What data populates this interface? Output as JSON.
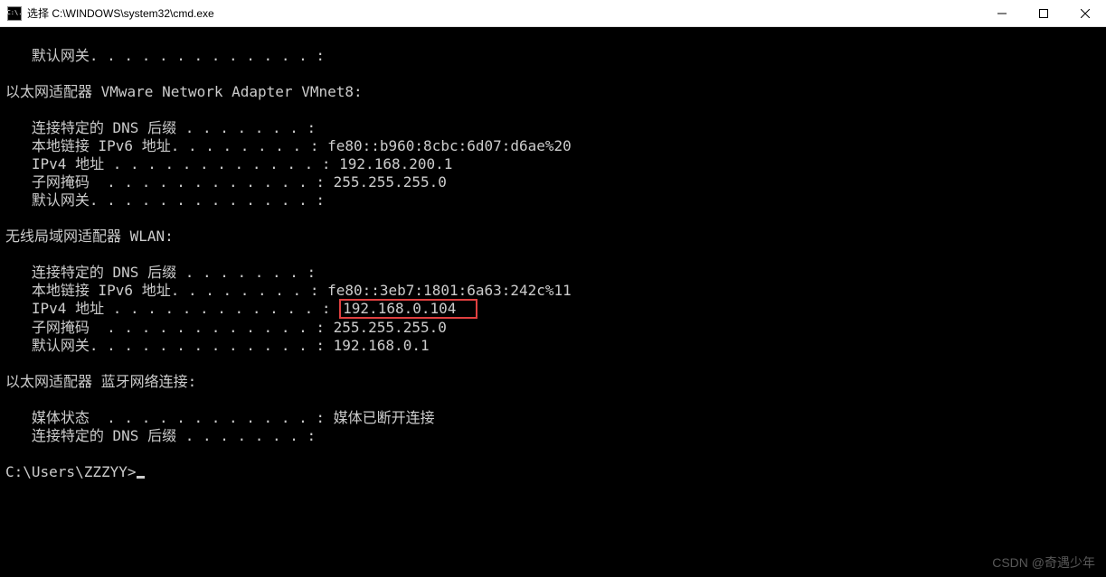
{
  "window": {
    "title": "选择 C:\\WINDOWS\\system32\\cmd.exe",
    "icon_text": "C:\\."
  },
  "watermark": "CSDN @奇遇少年",
  "terminal": {
    "sec0_default_gateway_label": "   默认网关. . . . . . . . . . . . . :",
    "blank": "",
    "sec1_header": "以太网适配器 VMware Network Adapter VMnet8:",
    "sec1_dns_suffix": "   连接特定的 DNS 后缀 . . . . . . . :",
    "sec1_ipv6_label": "   本地链接 IPv6 地址. . . . . . . . : ",
    "sec1_ipv6_value": "fe80::b960:8cbc:6d07:d6ae%20",
    "sec1_ipv4_label": "   IPv4 地址 . . . . . . . . . . . . : ",
    "sec1_ipv4_value": "192.168.200.1",
    "sec1_mask_label": "   子网掩码  . . . . . . . . . . . . : ",
    "sec1_mask_value": "255.255.255.0",
    "sec1_gw_label": "   默认网关. . . . . . . . . . . . . :",
    "sec2_header": "无线局域网适配器 WLAN:",
    "sec2_dns_suffix": "   连接特定的 DNS 后缀 . . . . . . . :",
    "sec2_ipv6_label": "   本地链接 IPv6 地址. . . . . . . . : ",
    "sec2_ipv6_value": "fe80::3eb7:1801:6a63:242c%11",
    "sec2_ipv4_label": "   IPv4 地址 . . . . . . . . . . . . : ",
    "sec2_ipv4_value": "192.168.0.104  ",
    "sec2_mask_label": "   子网掩码  . . . . . . . . . . . . : ",
    "sec2_mask_value": "255.255.255.0",
    "sec2_gw_label": "   默认网关. . . . . . . . . . . . . : ",
    "sec2_gw_value": "192.168.0.1",
    "sec3_header": "以太网适配器 蓝牙网络连接:",
    "sec3_media_label": "   媒体状态  . . . . . . . . . . . . : ",
    "sec3_media_value": "媒体已断开连接",
    "sec3_dns_suffix": "   连接特定的 DNS 后缀 . . . . . . . :",
    "prompt": "C:\\Users\\ZZZYY>"
  }
}
